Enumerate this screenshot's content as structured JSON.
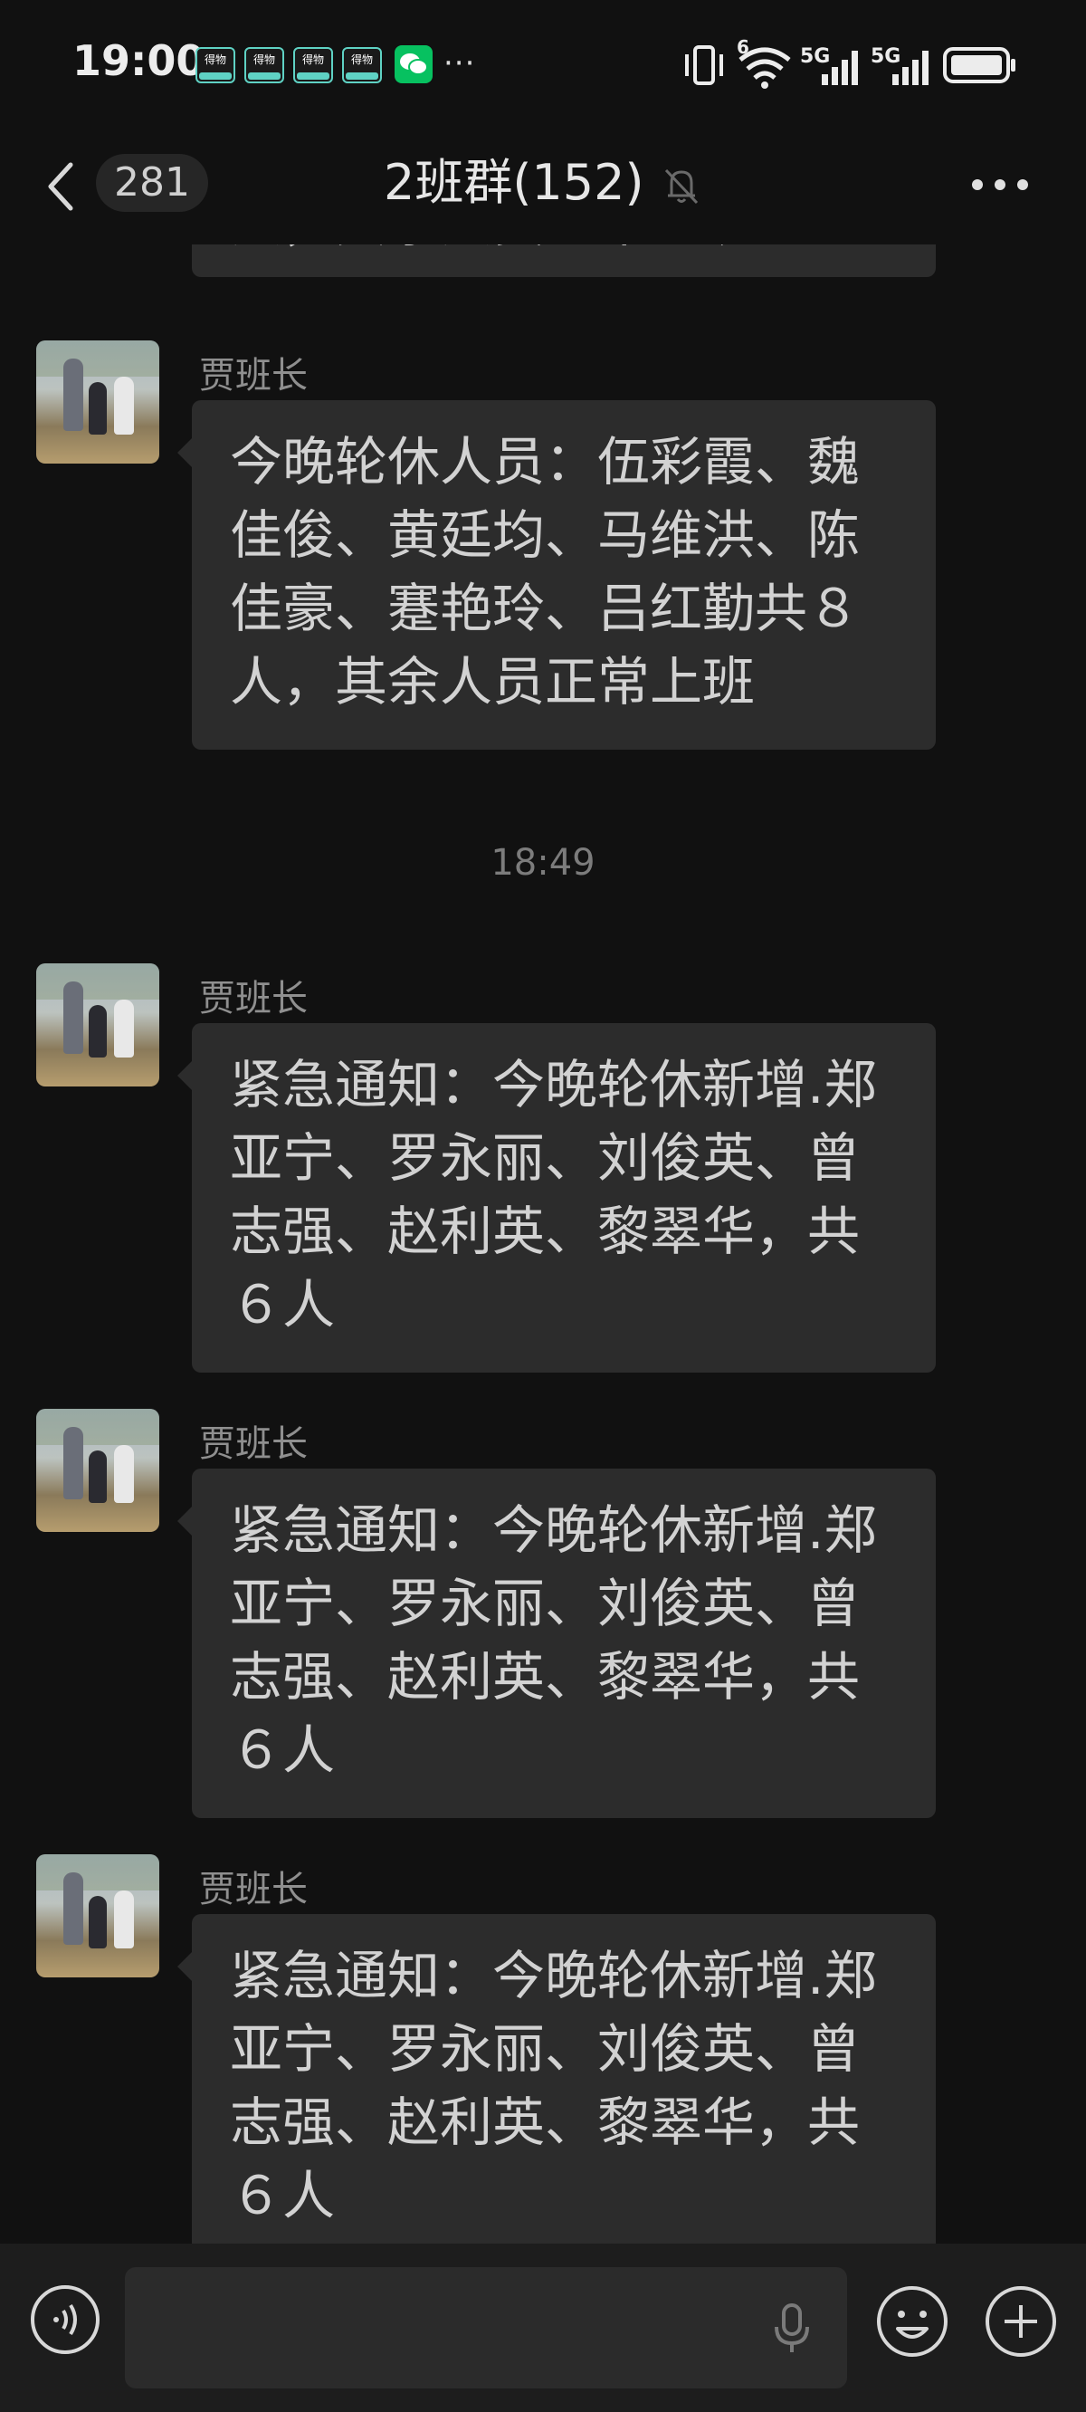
{
  "status_bar": {
    "time": "19:00",
    "notification_labels": [
      "得物",
      "得物",
      "得物",
      "得物"
    ],
    "network_1": "5G",
    "network_2": "5G",
    "wifi_badge": "6"
  },
  "header": {
    "unread_count": "281",
    "title": "2班群(152)"
  },
  "messages": [
    {
      "sender": "",
      "text": "人，其余人员正常上班"
    },
    {
      "sender": "贾班长",
      "text": "今晚轮休人员：伍彩霞、魏佳俊、黄廷均、马维洪、陈佳豪、蹇艳玲、吕红勤共８人，其余人员正常上班"
    },
    {
      "sender": "贾班长",
      "text": "紧急通知：今晚轮休新增.郑亚宁、罗永丽、刘俊英、曾志强、赵利英、黎翠华，共６人"
    },
    {
      "sender": "贾班长",
      "text": "紧急通知：今晚轮休新增.郑亚宁、罗永丽、刘俊英、曾志强、赵利英、黎翠华，共６人"
    },
    {
      "sender": "贾班长",
      "text": "紧急通知：今晚轮休新增.郑亚宁、罗永丽、刘俊英、曾志强、赵利英、黎翠华，共６人"
    }
  ],
  "timestamp": "18:49",
  "input": {
    "value": "",
    "placeholder": ""
  },
  "icons": {
    "back": "chevron-left-icon",
    "mute": "bell-off-icon",
    "menu": "more-horizontal-icon",
    "voice": "voice-wave-icon",
    "mic": "microphone-icon",
    "emoji": "smile-icon",
    "plus": "plus-circle-icon"
  },
  "colors": {
    "background": "#111111",
    "bubble": "#2c2c2c",
    "wechat_green": "#07c160"
  }
}
